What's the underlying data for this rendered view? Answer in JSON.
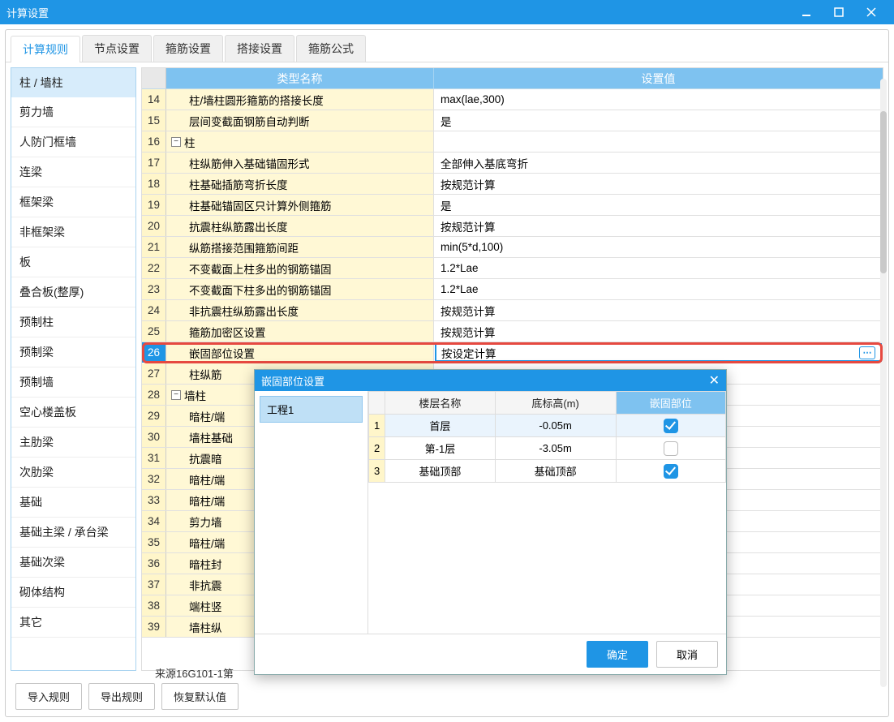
{
  "window": {
    "title": "计算设置"
  },
  "tabs": [
    "计算规则",
    "节点设置",
    "箍筋设置",
    "搭接设置",
    "箍筋公式"
  ],
  "activeTab": 0,
  "sidebar": {
    "items": [
      "柱 / 墙柱",
      "剪力墙",
      "人防门框墙",
      "连梁",
      "框架梁",
      "非框架梁",
      "板",
      "叠合板(整厚)",
      "预制柱",
      "预制梁",
      "预制墙",
      "空心楼盖板",
      "主肋梁",
      "次肋梁",
      "基础",
      "基础主梁 / 承台梁",
      "基础次梁",
      "砌体结构",
      "其它"
    ],
    "activeIndex": 0
  },
  "grid": {
    "headers": {
      "type": "类型名称",
      "value": "设置值"
    },
    "rows": [
      {
        "n": 14,
        "indent": 1,
        "name": "柱/墙柱圆形箍筋的搭接长度",
        "value": "max(lae,300)"
      },
      {
        "n": 15,
        "indent": 1,
        "name": "层间变截面钢筋自动判断",
        "value": "是"
      },
      {
        "n": 16,
        "group": true,
        "name": "柱"
      },
      {
        "n": 17,
        "indent": 1,
        "name": "柱纵筋伸入基础锚固形式",
        "value": "全部伸入基底弯折"
      },
      {
        "n": 18,
        "indent": 1,
        "name": "柱基础插筋弯折长度",
        "value": "按规范计算"
      },
      {
        "n": 19,
        "indent": 1,
        "name": "柱基础锚固区只计算外侧箍筋",
        "value": "是"
      },
      {
        "n": 20,
        "indent": 1,
        "name": "抗震柱纵筋露出长度",
        "value": "按规范计算"
      },
      {
        "n": 21,
        "indent": 1,
        "name": "纵筋搭接范围箍筋间距",
        "value": "min(5*d,100)"
      },
      {
        "n": 22,
        "indent": 1,
        "name": "不变截面上柱多出的钢筋锚固",
        "value": "1.2*Lae"
      },
      {
        "n": 23,
        "indent": 1,
        "name": "不变截面下柱多出的钢筋锚固",
        "value": "1.2*Lae"
      },
      {
        "n": 24,
        "indent": 1,
        "name": "非抗震柱纵筋露出长度",
        "value": "按规范计算"
      },
      {
        "n": 25,
        "indent": 1,
        "name": "箍筋加密区设置",
        "value": "按规范计算"
      },
      {
        "n": 26,
        "indent": 1,
        "name": "嵌固部位设置",
        "value": "按设定计算",
        "highlight": true,
        "picker": true
      },
      {
        "n": 27,
        "indent": 1,
        "name": "柱纵筋",
        "value": ""
      },
      {
        "n": 28,
        "group": true,
        "name": "墙柱"
      },
      {
        "n": 29,
        "indent": 1,
        "name": "暗柱/端",
        "value": ""
      },
      {
        "n": 30,
        "indent": 1,
        "name": "墙柱基础",
        "value": ""
      },
      {
        "n": 31,
        "indent": 1,
        "name": "抗震暗",
        "value": ""
      },
      {
        "n": 32,
        "indent": 1,
        "name": "暗柱/端",
        "value": ""
      },
      {
        "n": 33,
        "indent": 1,
        "name": "暗柱/端",
        "value": ""
      },
      {
        "n": 34,
        "indent": 1,
        "name": "剪力墙",
        "value": ""
      },
      {
        "n": 35,
        "indent": 1,
        "name": "暗柱/端",
        "value": ""
      },
      {
        "n": 36,
        "indent": 1,
        "name": "暗柱封",
        "value": ""
      },
      {
        "n": 37,
        "indent": 1,
        "name": "非抗震",
        "value": ""
      },
      {
        "n": 38,
        "indent": 1,
        "name": "端柱竖",
        "value": ""
      },
      {
        "n": 39,
        "indent": 1,
        "name": "墙柱纵",
        "value": ""
      }
    ]
  },
  "footer": {
    "source": "来源16G101-1第"
  },
  "buttons": {
    "import": "导入规则",
    "export": "导出规则",
    "reset": "恢复默认值"
  },
  "dialog": {
    "title": "嵌固部位设置",
    "tree": [
      "工程1"
    ],
    "headers": {
      "floor": "楼层名称",
      "elev": "底标高(m)",
      "fixed": "嵌固部位"
    },
    "rows": [
      {
        "i": 1,
        "floor": "首层",
        "elev": "-0.05m",
        "checked": true
      },
      {
        "i": 2,
        "floor": "第-1层",
        "elev": "-3.05m",
        "checked": false
      },
      {
        "i": 3,
        "floor": "基础顶部",
        "elev": "基础顶部",
        "checked": true
      }
    ],
    "ok": "确定",
    "cancel": "取消"
  }
}
